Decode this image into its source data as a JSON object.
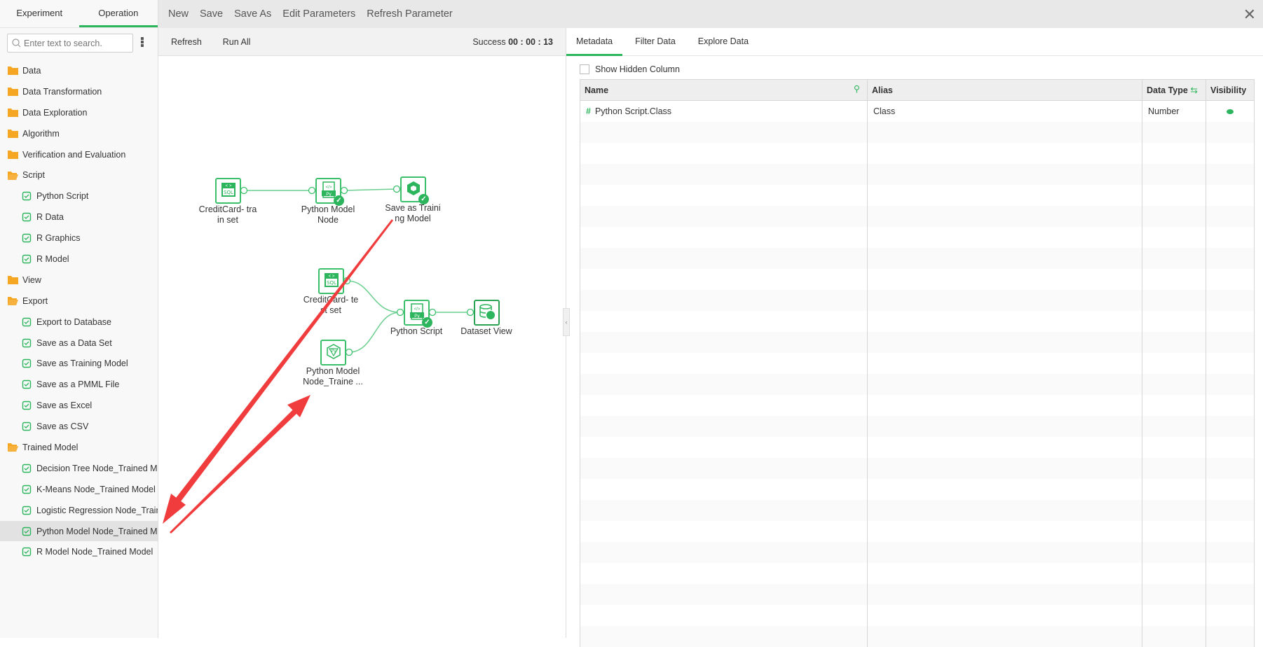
{
  "sidebar": {
    "tabs": [
      "Experiment",
      "Operation"
    ],
    "active_tab": "Operation",
    "search_placeholder": "Enter text to search.",
    "items": [
      {
        "label": "Data",
        "type": "folder",
        "open": false
      },
      {
        "label": "Data Transformation",
        "type": "folder",
        "open": false
      },
      {
        "label": "Data Exploration",
        "type": "folder",
        "open": false
      },
      {
        "label": "Algorithm",
        "type": "folder",
        "open": false
      },
      {
        "label": "Verification and Evaluation",
        "type": "folder",
        "open": false
      },
      {
        "label": "Script",
        "type": "folder",
        "open": true
      },
      {
        "label": "Python Script",
        "type": "child",
        "icon": "python-script-icon"
      },
      {
        "label": "R Data",
        "type": "child",
        "icon": "r-data-icon"
      },
      {
        "label": "R Graphics",
        "type": "child",
        "icon": "r-graphics-icon"
      },
      {
        "label": "R Model",
        "type": "child",
        "icon": "r-model-icon"
      },
      {
        "label": "View",
        "type": "folder",
        "open": false
      },
      {
        "label": "Export",
        "type": "folder",
        "open": true
      },
      {
        "label": "Export to Database",
        "type": "child",
        "icon": "database-export-icon"
      },
      {
        "label": "Save as a Data Set",
        "type": "child",
        "icon": "layers-icon"
      },
      {
        "label": "Save as Training Model",
        "type": "child",
        "icon": "cube-icon"
      },
      {
        "label": "Save as a PMML File",
        "type": "child",
        "icon": "file-icon"
      },
      {
        "label": "Save as Excel",
        "type": "child",
        "icon": "excel-icon"
      },
      {
        "label": "Save as CSV",
        "type": "child",
        "icon": "csv-icon"
      },
      {
        "label": "Trained Model",
        "type": "folder",
        "open": true
      },
      {
        "label": "Decision Tree Node_Trained Model",
        "type": "child",
        "icon": "tree-icon"
      },
      {
        "label": "K-Means Node_Trained Model",
        "type": "child",
        "icon": "scatter-icon"
      },
      {
        "label": "Logistic Regression Node_Trained Model",
        "type": "child",
        "icon": "regression-icon"
      },
      {
        "label": "Python Model Node_Trained Model",
        "type": "child",
        "icon": "model-icon",
        "selected": true
      },
      {
        "label": "R Model Node_Trained Model",
        "type": "child",
        "icon": "model-icon"
      }
    ]
  },
  "toolbar": {
    "items": [
      "New",
      "Save",
      "Save As",
      "Edit Parameters",
      "Refresh Parameter"
    ]
  },
  "subbar": {
    "refresh": "Refresh",
    "run_all": "Run All",
    "status_label": "Success",
    "elapsed": "00 : 00 : 13"
  },
  "canvas": {
    "nodes": [
      {
        "id": "train",
        "label1": "CreditCard- tra",
        "label2": "in set",
        "icon": "sql-icon",
        "done": false
      },
      {
        "id": "pymodel",
        "label1": "Python Model",
        "label2": "Node",
        "icon": "python-icon",
        "done": true
      },
      {
        "id": "savetrain",
        "label1": "Save as Traini",
        "label2": "ng Model",
        "icon": "cube-icon",
        "done": true
      },
      {
        "id": "test",
        "label1": "CreditCard- te",
        "label2": "st set",
        "icon": "sql-icon",
        "done": false
      },
      {
        "id": "pyscript",
        "label1": "Python Script",
        "label2": "",
        "icon": "python-icon",
        "done": true
      },
      {
        "id": "dsview",
        "label1": "Dataset View",
        "label2": "",
        "icon": "dataset-view-icon",
        "done": false
      },
      {
        "id": "trained",
        "label1": "Python Model",
        "label2": "Node_Traine ...",
        "icon": "model-icon",
        "done": false
      }
    ]
  },
  "right": {
    "tabs": [
      "Metadata",
      "Filter Data",
      "Explore Data"
    ],
    "active_tab": "Metadata",
    "show_hidden_label": "Show Hidden Column",
    "columns": [
      "Name",
      "Alias",
      "Data Type",
      "Visibility"
    ],
    "rows": [
      {
        "name": "Python Script.Class",
        "alias": "Class",
        "type": "Number",
        "visible": true
      }
    ]
  },
  "colors": {
    "accent": "#2db55d",
    "folder": "#f5a623",
    "annotation_arrow": "#f03c3c"
  }
}
